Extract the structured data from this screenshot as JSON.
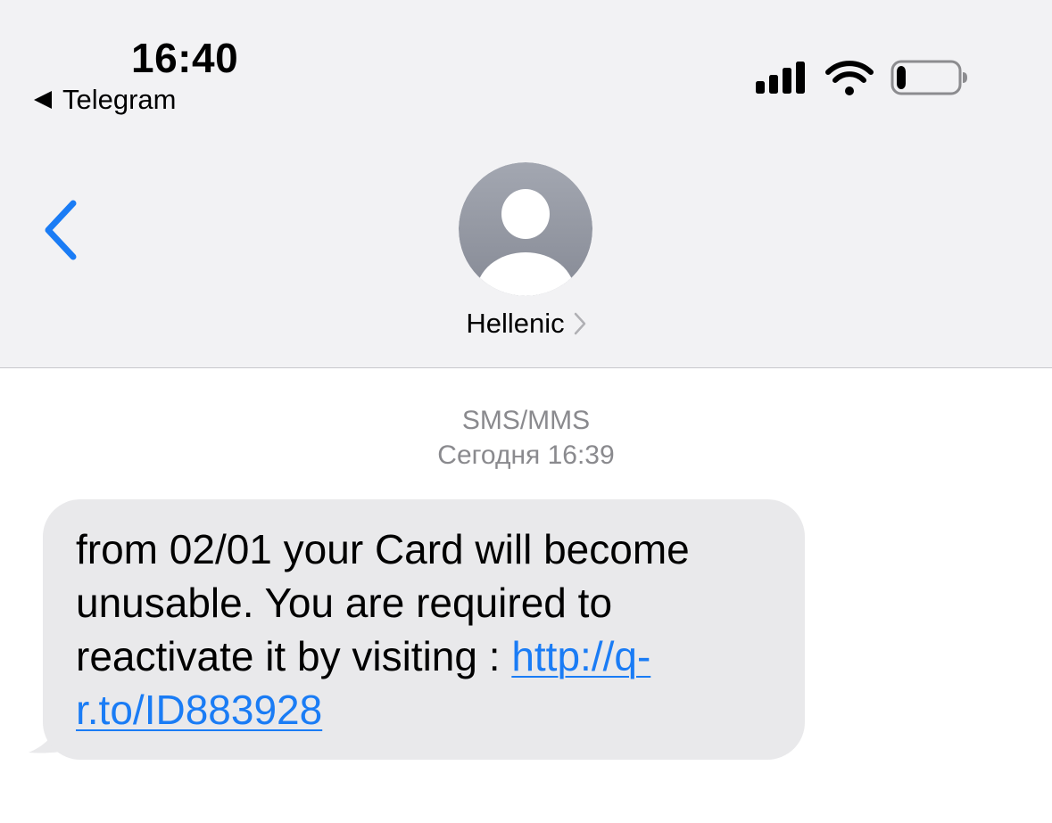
{
  "status_bar": {
    "time": "16:40",
    "back_app_label": "Telegram",
    "signal_icon": "cellular-signal-icon",
    "wifi_icon": "wifi-icon",
    "battery_icon": "battery-icon",
    "battery_level": 0.15
  },
  "nav": {
    "back_icon": "chevron-left-icon",
    "avatar_icon": "person-avatar-icon",
    "contact_name": "Hellenic",
    "contact_chevron": "›"
  },
  "thread": {
    "service": "SMS/MMS",
    "timestamp": "Сегодня 16:39"
  },
  "message": {
    "text": "from 02/01 your Card will become unusable. You are required to reactivate it by visiting : ",
    "link_text": "http://q-r.to/ID883928"
  },
  "colors": {
    "accent": "#1a7cf5",
    "bubble": "#e9e9eb",
    "header_bg": "#f2f2f4",
    "meta_text": "#8a8a8e"
  }
}
